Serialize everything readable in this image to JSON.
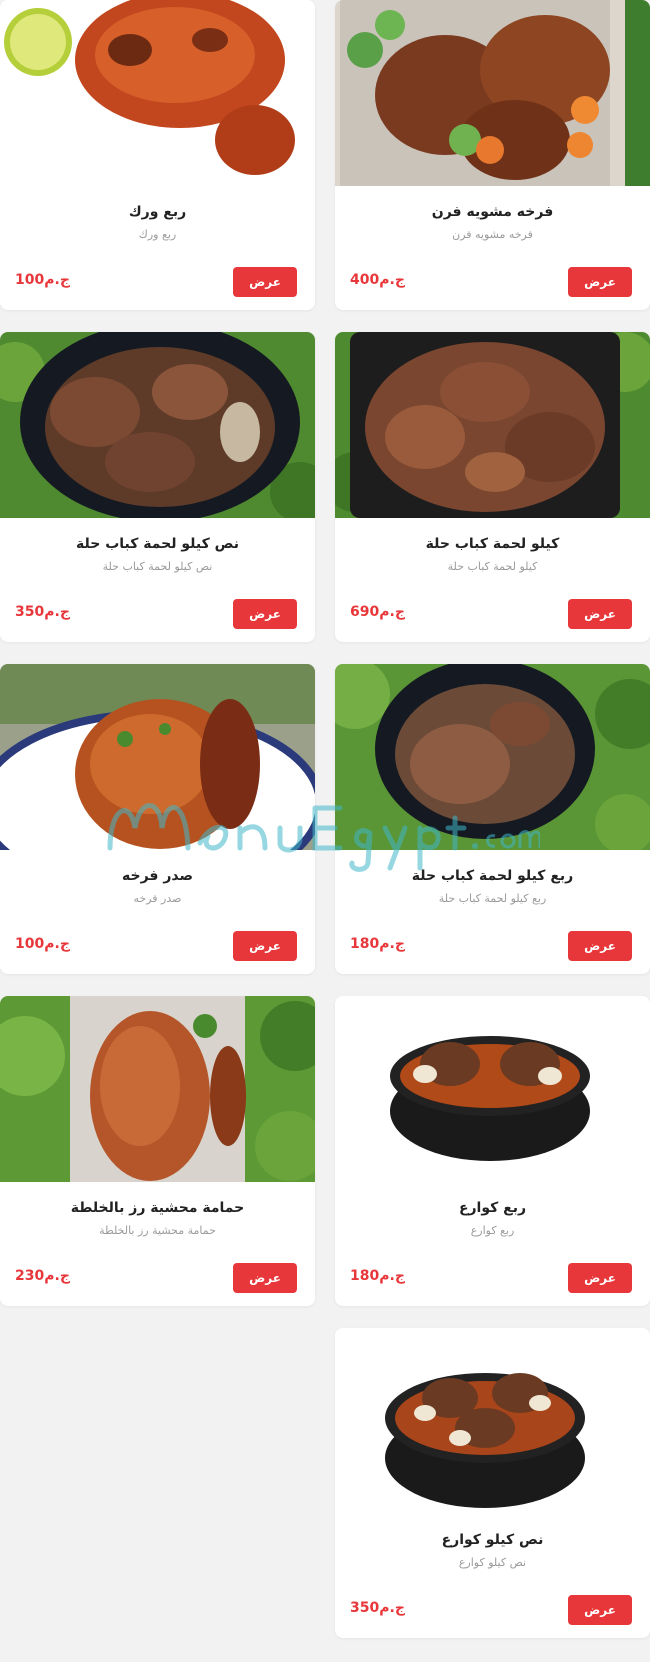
{
  "accent_color": "#e8373a",
  "currency": "ج.م",
  "view_label": "عرض",
  "watermark_text": "MenuEgypt.com",
  "items": [
    {
      "name": "فرخه مشويه فرن",
      "desc": "فرخه مشويه فرن",
      "price": "400",
      "image": "roasted-chicken-vegetables-photo"
    },
    {
      "name": "ربع ورك",
      "desc": "ربع ورك",
      "price": "100",
      "image": "chicken-leg-lemon-photo"
    },
    {
      "name": "كيلو لحمة كباب حلة",
      "desc": "كيلو لحمة كباب حلة",
      "price": "690",
      "image": "meat-kebab-tray-photo"
    },
    {
      "name": "نص كيلو لحمة كباب حلة",
      "desc": "نص كيلو لحمة كباب حلة",
      "price": "350",
      "image": "meat-kebab-bowl-photo"
    },
    {
      "name": "ربع كيلو لحمة كباب حلة",
      "desc": "ربع كيلو لحمة كباب حلة",
      "price": "180",
      "image": "meat-kebab-small-bowl-photo"
    },
    {
      "name": "صدر فرخه",
      "desc": "صدر فرخه",
      "price": "100",
      "image": "chicken-breast-plate-photo"
    },
    {
      "name": "ربع كوارع",
      "desc": "ربع كوارع",
      "price": "180",
      "image": "trotters-bowl-photo"
    },
    {
      "name": "حمامة محشية رز بالخلطة",
      "desc": "حمامة محشية رز بالخلطة",
      "price": "230",
      "image": "stuffed-pigeon-photo"
    },
    {
      "name": "نص كيلو كوارع",
      "desc": "نص كيلو كوارع",
      "price": "350",
      "image": "trotters-large-bowl-photo"
    }
  ]
}
